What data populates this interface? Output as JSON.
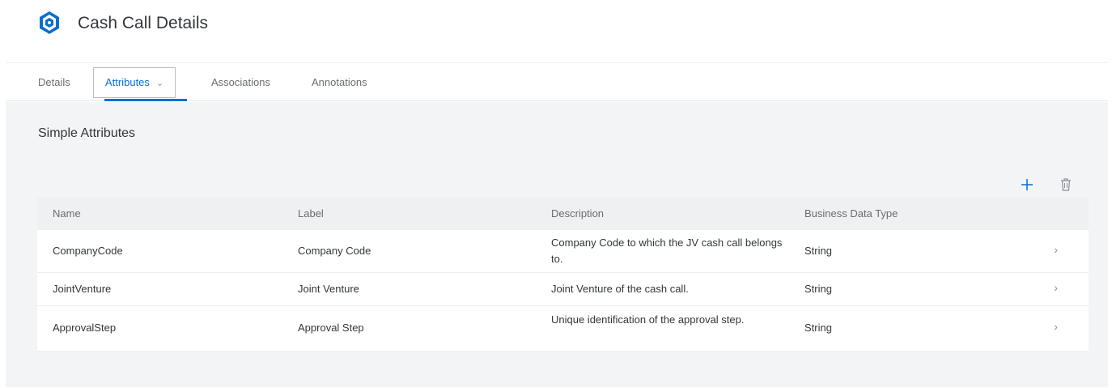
{
  "header": {
    "title": "Cash Call Details",
    "logo_icon": "cube-icon"
  },
  "tabs": [
    {
      "label": "Details",
      "active": false
    },
    {
      "label": "Attributes",
      "active": true
    },
    {
      "label": "Associations",
      "active": false
    },
    {
      "label": "Annotations",
      "active": false
    }
  ],
  "section": {
    "title": "Simple Attributes"
  },
  "toolbar": {
    "add_icon": "plus-icon",
    "delete_icon": "trash-icon"
  },
  "table": {
    "columns": [
      "Name",
      "Label",
      "Description",
      "Business Data Type"
    ],
    "rows": [
      {
        "name": "CompanyCode",
        "label": "Company Code",
        "description": "Company Code to which the JV cash call belongs to.",
        "type": "String"
      },
      {
        "name": "JointVenture",
        "label": "Joint Venture",
        "description": "Joint Venture of the cash call.",
        "type": "String"
      },
      {
        "name": "ApprovalStep",
        "label": "Approval Step",
        "description": "Unique identification of the approval step.",
        "type": "String"
      }
    ]
  },
  "colors": {
    "accent": "#0a6ed1",
    "background": "#f3f4f5",
    "text": "#32363a",
    "muted_text": "#6a6d70"
  }
}
